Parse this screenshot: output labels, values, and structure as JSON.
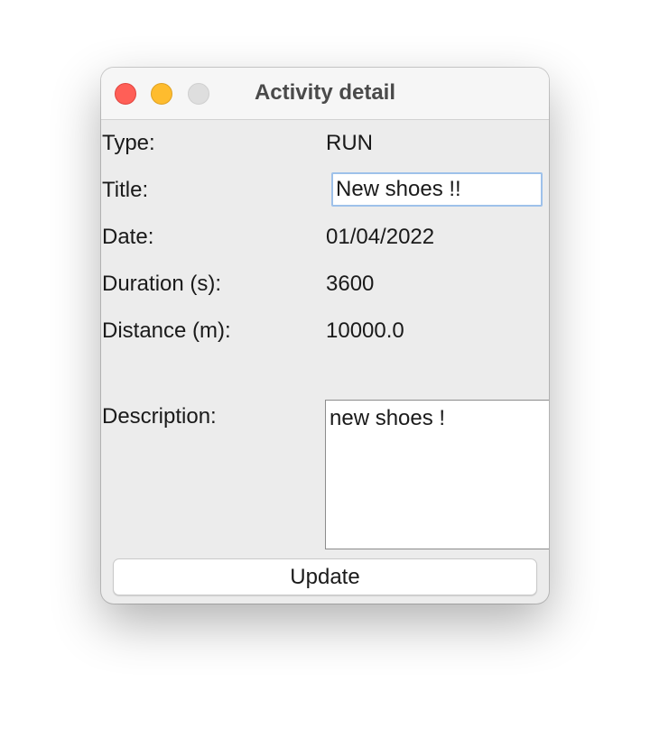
{
  "window": {
    "title": "Activity detail"
  },
  "fields": {
    "type_label": "Type:",
    "type_value": "RUN",
    "title_label": "Title:",
    "title_value": "New shoes !!",
    "date_label": "Date:",
    "date_value": "01/04/2022",
    "duration_label": "Duration (s):",
    "duration_value": "3600",
    "distance_label": "Distance (m):",
    "distance_value": "10000.0",
    "description_label": "Description:",
    "description_value": "new shoes !"
  },
  "actions": {
    "update_label": "Update"
  },
  "colors": {
    "close": "#ff5f57",
    "minimize": "#febc2e",
    "zoom_disabled": "#dedede",
    "focus_ring": "#9ec1ea"
  },
  "icons": [
    "close-button-icon",
    "minimize-button-icon",
    "zoom-button-icon"
  ]
}
